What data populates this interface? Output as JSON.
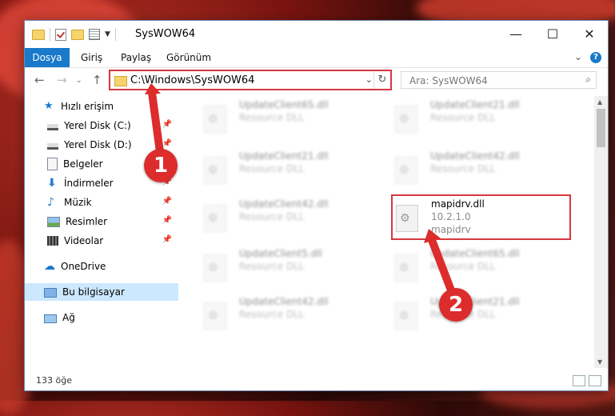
{
  "window": {
    "title": "SysWOW64"
  },
  "ribbon": {
    "tabs": [
      "Dosya",
      "Giriş",
      "Paylaş",
      "Görünüm"
    ],
    "help": "?"
  },
  "address": {
    "path": "C:\\Windows\\SysWOW64"
  },
  "search": {
    "placeholder": "Ara: SysWOW64"
  },
  "nav": {
    "quick_access": "Hızlı erişim",
    "items": [
      "Yerel Disk (C:)",
      "Yerel Disk (D:)",
      "Belgeler",
      "İndirmeler",
      "Müzik",
      "Resimler",
      "Videolar"
    ],
    "onedrive": "OneDrive",
    "this_pc": "Bu bilgisayar",
    "network": "Ağ"
  },
  "files": [
    {
      "name": "UpdateClient65.dll",
      "desc": "Resource DLL"
    },
    {
      "name": "UpdateClient21.dll",
      "desc": "Resource DLL"
    },
    {
      "name": "UpdateClient21.dll",
      "desc": "Resource DLL"
    },
    {
      "name": "UpdateClient42.dll",
      "desc": "Resource DLL"
    },
    {
      "name": "UpdateClient42.dll",
      "desc": "Resource DLL"
    },
    {
      "name": "mapidrv.dll",
      "desc": "10.2.1.0",
      "extra": "mapidrv"
    },
    {
      "name": "UpdateClient5.dll",
      "desc": "Resource DLL"
    },
    {
      "name": "UpdateClient65.dll",
      "desc": "Resource DLL"
    },
    {
      "name": "UpdateClient42.dll",
      "desc": "Resource DLL"
    },
    {
      "name": "UpdateClient21.dll",
      "desc": "Resource DLL"
    }
  ],
  "status": {
    "count": "133 öğe"
  },
  "callouts": [
    "1",
    "2"
  ],
  "colors": {
    "accent": "#1979ca",
    "highlight": "#d9363e",
    "selected": "#cce8ff"
  }
}
